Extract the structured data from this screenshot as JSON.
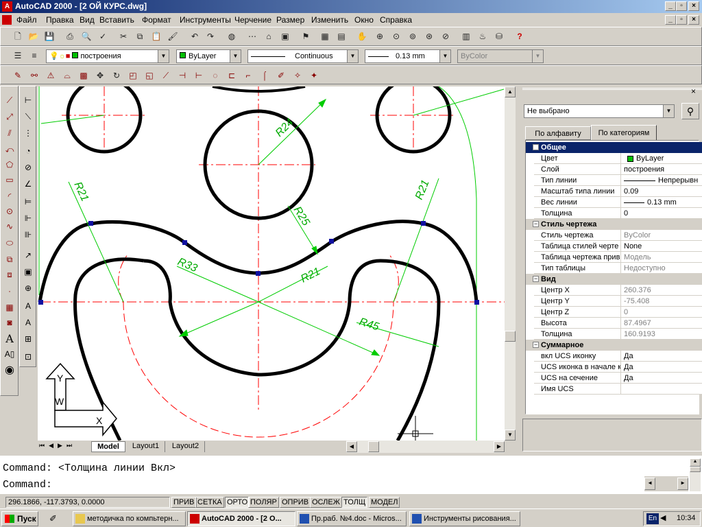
{
  "window": {
    "title": "AutoCAD 2000 - [2 ОЙ КУРС.dwg]"
  },
  "menu": [
    "Файл",
    "Правка",
    "Вид",
    "Вставить",
    "Формат",
    "Инструменты",
    "Черчение",
    "Размер",
    "Изменить",
    "Окно",
    "Справка"
  ],
  "toolbar2": {
    "layer": "построения",
    "color": "ByLayer",
    "linetype": "Continuous",
    "lineweight": "0.13 mm",
    "plotstyle": "ByColor"
  },
  "drawing": {
    "dims": {
      "r24": "R24",
      "r21a": "R21",
      "r21b": "R21",
      "r25": "R25",
      "r33": "R33",
      "r21c": "R21",
      "r45": "R45"
    },
    "ucs": {
      "y": "Y",
      "w": "W",
      "x": "X"
    }
  },
  "tabs": {
    "model": "Model",
    "layout1": "Layout1",
    "layout2": "Layout2"
  },
  "props": {
    "selection": "Не выбрано",
    "tab_alpha": "По алфавиту",
    "tab_cat": "По категориям",
    "general": {
      "title": "Общее",
      "rows": [
        {
          "k": "Цвет",
          "v": "ByLayer"
        },
        {
          "k": "Слой",
          "v": "построения"
        },
        {
          "k": "Тип линии",
          "v": "Непрерывн"
        },
        {
          "k": "Масштаб типа линии",
          "v": "0.09"
        },
        {
          "k": "Вес линии",
          "v": "0.13 mm"
        },
        {
          "k": "Толщина",
          "v": "0"
        }
      ]
    },
    "plotstyle": {
      "title": "Стиль чертежа",
      "rows": [
        {
          "k": "Стиль чертежа",
          "v": "ByColor"
        },
        {
          "k": "Таблица стилей черте",
          "v": "None"
        },
        {
          "k": "Таблица чертежа прив",
          "v": "Модель"
        },
        {
          "k": "Тип таблицы",
          "v": "Недоступно"
        }
      ]
    },
    "view": {
      "title": "Вид",
      "rows": [
        {
          "k": "Центр X",
          "v": "260.376"
        },
        {
          "k": "Центр Y",
          "v": "-75.408"
        },
        {
          "k": "Центр Z",
          "v": "0"
        },
        {
          "k": "Высота",
          "v": "87.4967"
        },
        {
          "k": "Толщина",
          "v": "160.9193"
        }
      ]
    },
    "misc": {
      "title": "Суммарное",
      "rows": [
        {
          "k": "вкл UCS иконку",
          "v": "Да"
        },
        {
          "k": "UCS иконка в начале к",
          "v": "Да"
        },
        {
          "k": "UCS на сечение",
          "v": "Да"
        },
        {
          "k": "Имя UCS",
          "v": ""
        }
      ]
    }
  },
  "command": {
    "line1": "Command:  <Толщина линии Вкл>",
    "line2": "Command:"
  },
  "status": {
    "coords": "296.1866, -117.3793, 0.0000",
    "buttons": [
      "ПРИВ",
      "СЕТКА",
      "ОРТО",
      "ПОЛЯР",
      "ОПРИВ",
      "ОСЛЕЖ",
      "ТОЛЩ",
      "МОДЕЛ"
    ]
  },
  "taskbar": {
    "start": "Пуск",
    "items": [
      "методичка по компьтерн...",
      "AutoCAD 2000 - [2 О...",
      "Пр.раб. №4.doc - Micros...",
      "Инструменты рисования..."
    ],
    "lang": "En",
    "clock": "10:34"
  },
  "colors": {
    "accent": "#0a246a",
    "dims": "#00cc00",
    "centerlines": "#ff0000",
    "outline": "#000000"
  }
}
